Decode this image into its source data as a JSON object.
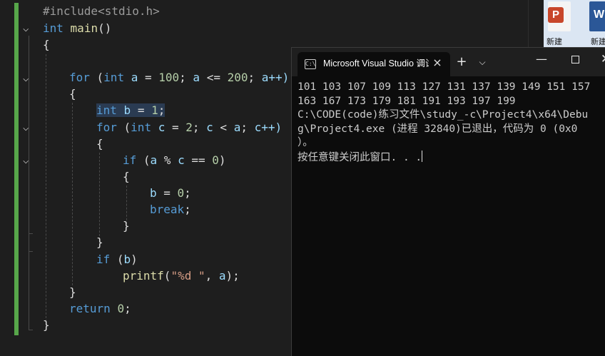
{
  "editor": {
    "lines": {
      "include": "#include<stdio.h>",
      "main_kw": "int",
      "main_fn": "main",
      "main_paren": "()",
      "open_main": "{",
      "for1_kw": "for",
      "for1_paren_open": " (",
      "for1_int": "int",
      "for1_a": " a ",
      "for1_eq": "= ",
      "for1_100": "100",
      "for1_semi1": "; ",
      "for1_a2": "a",
      "for1_le": " <= ",
      "for1_200": "200",
      "for1_semi2": "; ",
      "for1_inc": "a++)",
      "open_for1": "{",
      "decl_int": "int",
      "decl_b": " b ",
      "decl_eq": "= ",
      "decl_1": "1",
      "decl_semi": ";",
      "for2_kw": "for",
      "for2_p": " (",
      "for2_int": "int",
      "for2_c": " c ",
      "for2_eq": "= ",
      "for2_2": "2",
      "for2_s1": "; ",
      "for2_c2": "c ",
      "for2_lt": "< ",
      "for2_a": "a",
      "for2_s2": "; ",
      "for2_inc": "c++)",
      "open_for2": "{",
      "if1_kw": "if",
      "if1_p": " (",
      "if1_a": "a ",
      "if1_mod": "% ",
      "if1_c": "c ",
      "if1_eqeq": "== ",
      "if1_0": "0",
      "if1_close": ")",
      "open_if1": "{",
      "assign_b": "b ",
      "assign_eq": "= ",
      "assign_0": "0",
      "assign_semi": ";",
      "break_kw": "break",
      "break_semi": ";",
      "close_if1": "}",
      "close_for2": "}",
      "if2_kw": "if",
      "if2_p": " (",
      "if2_b": "b",
      "if2_close": ")",
      "printf_fn": "printf",
      "printf_open": "(",
      "printf_str": "\"%d \"",
      "printf_comma": ", ",
      "printf_a": "a",
      "printf_end": ");",
      "close_for1": "}",
      "return_kw": "return",
      "return_sp": " ",
      "return_0": "0",
      "return_semi": ";",
      "close_main": "}"
    }
  },
  "desktop": {
    "ppt_badge": "P",
    "word_badge": "W",
    "ppt_label": "新建",
    "word_label": "新建"
  },
  "terminal": {
    "tab_title": "Microsoft Visual Studio 调试控制台",
    "output": [
      "101 103 107 109 113 127 131 137 139 149 151 157",
      "163 167 173 179 181 191 193 197 199",
      "C:\\CODE(code)练习文件\\study_-c\\Project4\\x64\\Debu",
      "g\\Project4.exe (进程 32840)已退出，代码为 0 (0x0",
      "）。",
      "按任意键关闭此窗口. . ."
    ]
  },
  "colors": {
    "editor_bg": "#1e1e1e",
    "keyword": "#569cd6",
    "function": "#dcdcaa",
    "number": "#b5cea8",
    "string": "#d69d85",
    "change_bar": "#57a64a",
    "terminal_bg": "#0c0c0c"
  },
  "icons": [
    "chevron-down-icon",
    "console-icon",
    "close-icon",
    "plus-icon",
    "minimize-icon",
    "maximize-icon",
    "powerpoint-icon",
    "word-icon"
  ]
}
